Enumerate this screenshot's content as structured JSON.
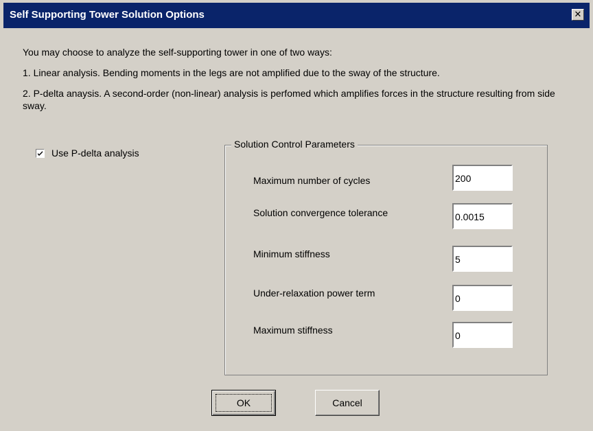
{
  "window": {
    "title": "Self Supporting Tower Solution Options",
    "close_glyph": "✕"
  },
  "description": {
    "intro": "You may choose to analyze the self-supporting tower in one of two ways:",
    "option1": "1. Linear analysis. Bending moments in the legs are not amplified due to the sway of the structure.",
    "option2": "2. P-delta anaysis. A second-order (non-linear) analysis is perfomed which amplifies forces in the structure resulting from side sway."
  },
  "pdelta_checkbox": {
    "label": "Use P-delta analysis",
    "checked": true
  },
  "solution_control": {
    "title": "Solution Control Parameters",
    "params": [
      {
        "label": "Maximum number of cycles",
        "value": "200"
      },
      {
        "label": "Solution convergence tolerance",
        "value": "0.0015"
      },
      {
        "label": "Minimum stiffness",
        "value": "5"
      },
      {
        "label": "Under-relaxation power term",
        "value": "0"
      },
      {
        "label": "Maximum stiffness",
        "value": "0"
      }
    ]
  },
  "buttons": {
    "ok": "OK",
    "cancel": "Cancel"
  },
  "colors": {
    "titlebar": "#0a246a",
    "face": "#d4d0c8"
  }
}
